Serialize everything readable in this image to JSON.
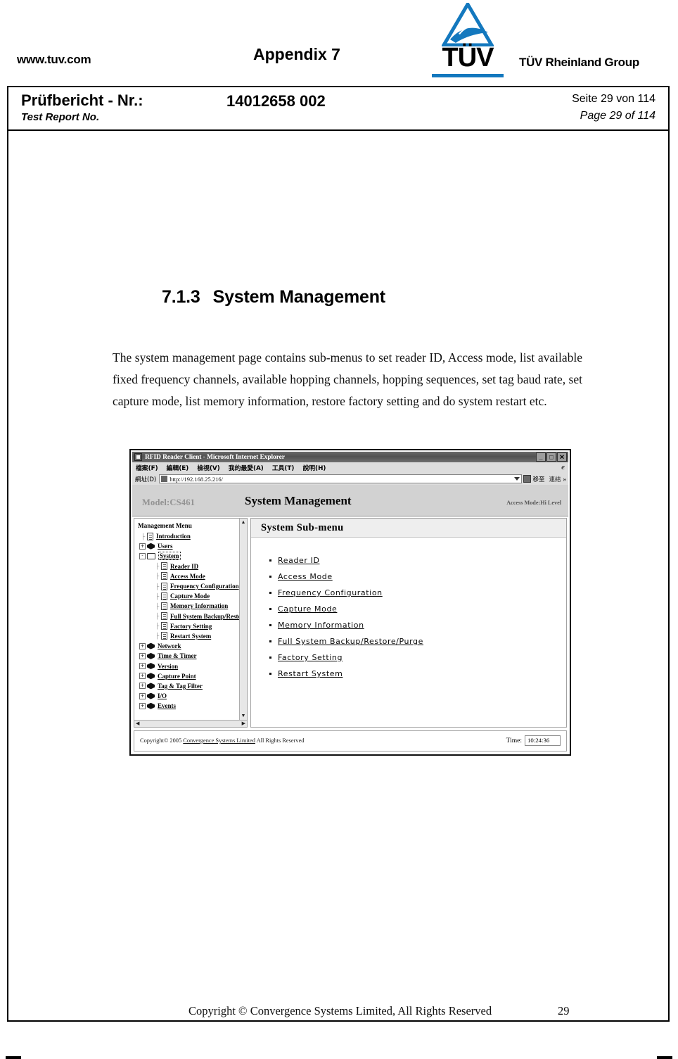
{
  "header": {
    "website": "www.tuv.com",
    "appendix": "Appendix 7",
    "logo_word": "TÜV",
    "logo_group": "TÜV Rheinland Group",
    "report_label_de": "Prüfbericht - Nr.:",
    "report_label_en": "Test Report No.",
    "report_number": "14012658 002",
    "page_de": "Seite 29 von 114",
    "page_en": "Page 29 of 114"
  },
  "section": {
    "number": "7.1.3",
    "title": "System Management",
    "paragraph": "The system management page contains sub-menus to set reader ID, Access mode, list available fixed frequency channels, available hopping channels, hopping sequences, set tag baud rate, set capture mode, list memory information, restore factory setting and do system restart etc."
  },
  "screenshot": {
    "window_title": "RFID Reader Client - Microsoft Internet Explorer",
    "window_buttons": [
      "_",
      "□",
      "✕"
    ],
    "menu_items": [
      "檔案(F)",
      "編輯(E)",
      "檢視(V)",
      "我的最愛(A)",
      "工具(T)",
      "說明(H)"
    ],
    "address_label": "網址(D)",
    "address_url": "http://192.168.25.216/",
    "go_label": "移至",
    "links_label": "連結",
    "chevron": "»",
    "banner": {
      "model": "Model:CS461",
      "title": "System Management",
      "access_mode": "Access Mode:Hi Level"
    },
    "tree": {
      "title": "Management Menu",
      "items": [
        {
          "label": "Introduction",
          "level": 1,
          "icon": "page-icon",
          "expander": "",
          "selected": false
        },
        {
          "label": "Users",
          "level": 1,
          "icon": "ball-icon",
          "expander": "+",
          "selected": false
        },
        {
          "label": "System",
          "level": 1,
          "icon": "folder-icon",
          "expander": "-",
          "selected": true
        },
        {
          "label": "Reader ID",
          "level": 2,
          "icon": "page-icon",
          "expander": "",
          "selected": false
        },
        {
          "label": "Access Mode",
          "level": 2,
          "icon": "page-icon",
          "expander": "",
          "selected": false
        },
        {
          "label": "Frequency Configuration",
          "level": 2,
          "icon": "page-icon",
          "expander": "",
          "selected": false
        },
        {
          "label": "Capture Mode",
          "level": 2,
          "icon": "page-icon",
          "expander": "",
          "selected": false
        },
        {
          "label": "Memory Information",
          "level": 2,
          "icon": "page-icon",
          "expander": "",
          "selected": false
        },
        {
          "label": "Full System Backup/Restore/Purge",
          "level": 2,
          "icon": "page-icon",
          "expander": "",
          "selected": false
        },
        {
          "label": "Factory Setting",
          "level": 2,
          "icon": "page-icon",
          "expander": "",
          "selected": false
        },
        {
          "label": "Restart System",
          "level": 2,
          "icon": "page-icon",
          "expander": "",
          "selected": false
        },
        {
          "label": "Network",
          "level": 1,
          "icon": "ball-icon",
          "expander": "+",
          "selected": false
        },
        {
          "label": "Time & Timer",
          "level": 1,
          "icon": "ball-icon",
          "expander": "+",
          "selected": false
        },
        {
          "label": "Version",
          "level": 1,
          "icon": "ball-icon",
          "expander": "+",
          "selected": false
        },
        {
          "label": "Capture Point",
          "level": 1,
          "icon": "ball-icon",
          "expander": "+",
          "selected": false
        },
        {
          "label": "Tag & Tag Filter",
          "level": 1,
          "icon": "ball-icon",
          "expander": "+",
          "selected": false
        },
        {
          "label": "I/O",
          "level": 1,
          "icon": "ball-icon",
          "expander": "+",
          "selected": false
        },
        {
          "label": "Events",
          "level": 1,
          "icon": "ball-icon",
          "expander": "+",
          "selected": false
        }
      ]
    },
    "submenu": {
      "title": "System  Sub-menu",
      "items": [
        "Reader  ID",
        "Access  Mode",
        "Frequency  Configuration",
        "Capture  Mode",
        "Memory  Information",
        "Full  System  Backup/Restore/Purge",
        "Factory  Setting",
        "Restart  System"
      ]
    },
    "footer": {
      "copyright_pre": "Copyright© 2005 ",
      "copyright_link": "Convergence Systems Limited",
      "copyright_post": "  All Rights Reserved",
      "time_label": "Time:",
      "time_value": "10:24:36"
    }
  },
  "page_footer": {
    "copyright": "Copyright © Convergence Systems Limited, All Rights Reserved",
    "page_number": "29"
  },
  "colors": {
    "tuv_blue": "#1378be"
  }
}
